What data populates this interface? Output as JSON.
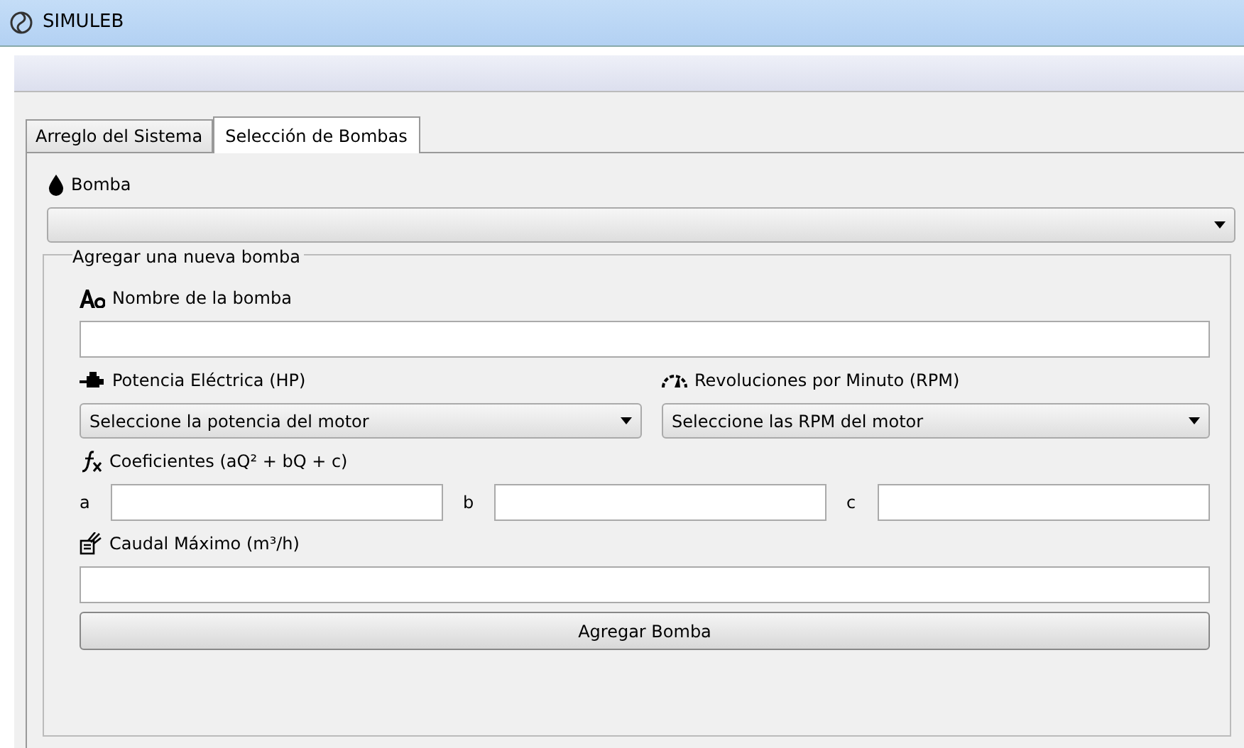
{
  "window": {
    "title": "SIMULEB"
  },
  "tabs": [
    {
      "label": "Arreglo del Sistema",
      "selected": false
    },
    {
      "label": "Selección de Bombas",
      "selected": true
    }
  ],
  "pump_selector": {
    "label": "Bomba"
  },
  "group": {
    "title": "Agregar una nueva bomba",
    "name_field": {
      "label": "Nombre de la bomba"
    },
    "power": {
      "label": "Potencia Eléctrica (HP)",
      "value": "Seleccione la potencia del motor"
    },
    "rpm": {
      "label": "Revoluciones por Minuto (RPM)",
      "value": "Seleccione las RPM del motor"
    },
    "coefficients": {
      "label": "Coeficientes (aQ² + bQ + c)",
      "fields": [
        {
          "label": "a"
        },
        {
          "label": "b"
        },
        {
          "label": "c"
        }
      ]
    },
    "max_flow": {
      "label": "Caudal Máximo (m³/h)"
    },
    "button": "Agregar Bomba"
  }
}
